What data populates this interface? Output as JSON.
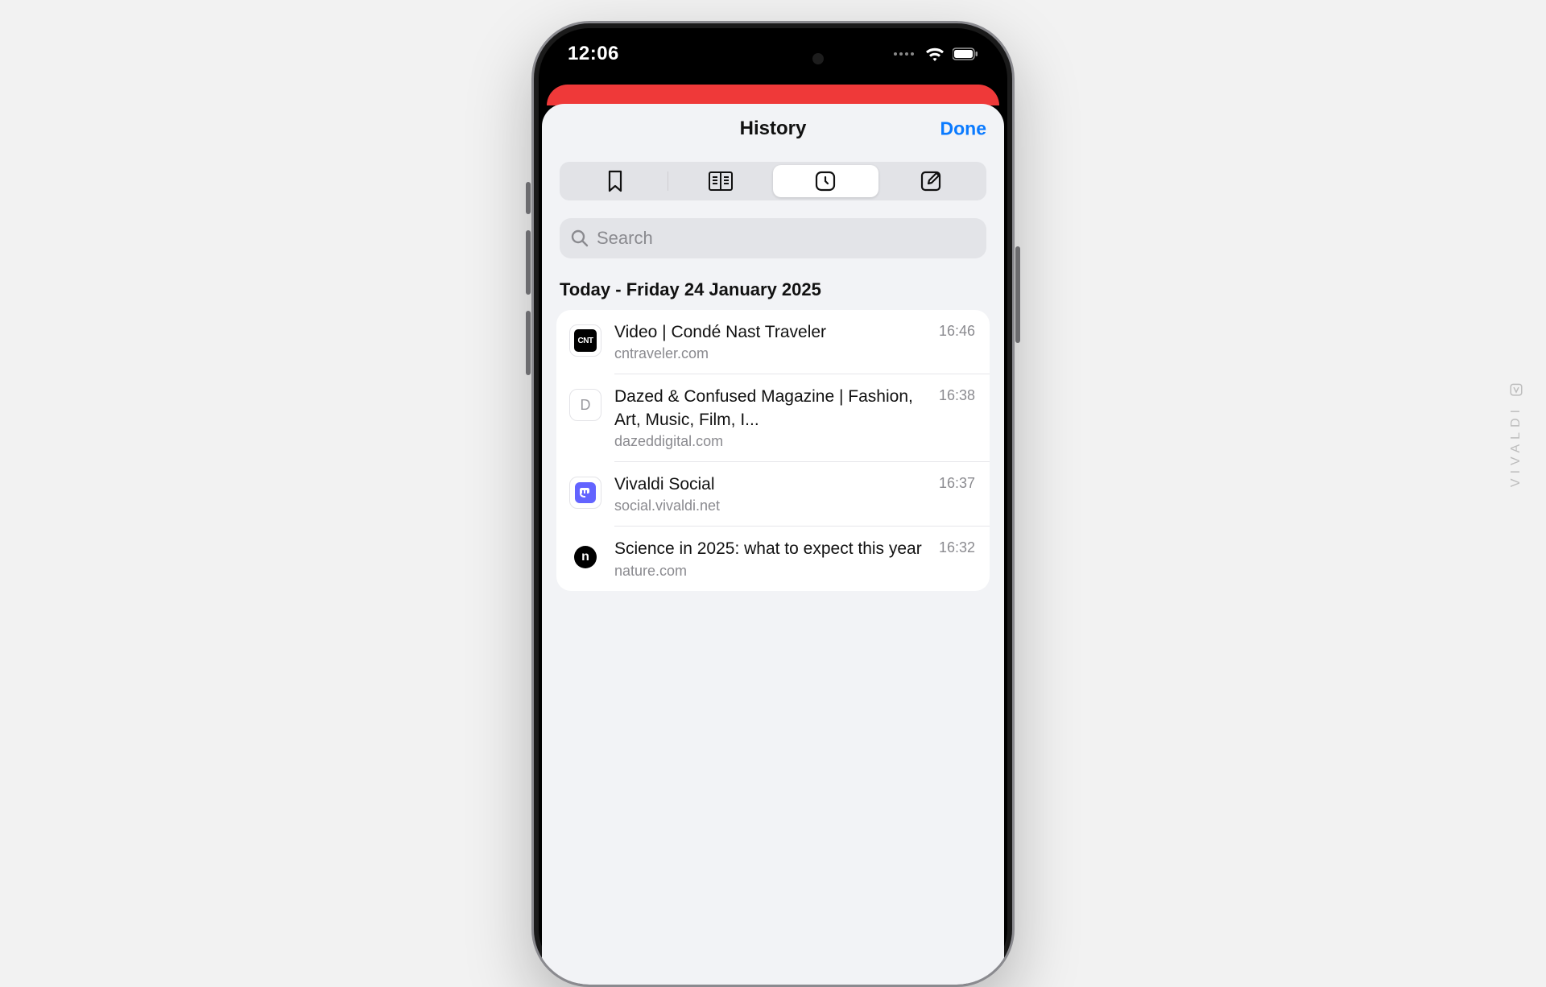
{
  "watermark": "VIVALDI",
  "statusbar": {
    "time": "12:06"
  },
  "sheet": {
    "title": "History",
    "done_label": "Done"
  },
  "tabs": {
    "active_index": 2,
    "items": [
      {
        "id": "bookmarks",
        "icon": "bookmark-icon"
      },
      {
        "id": "reading-list",
        "icon": "reading-list-icon"
      },
      {
        "id": "history",
        "icon": "history-icon"
      },
      {
        "id": "notes",
        "icon": "notes-icon"
      }
    ]
  },
  "search": {
    "placeholder": "Search",
    "value": ""
  },
  "section_header": "Today - Friday 24 January 2025",
  "history": [
    {
      "favicon": "cnt",
      "favicon_label": "CNT",
      "title": "Video | Condé Nast Traveler",
      "domain": "cntraveler.com",
      "time": "16:46"
    },
    {
      "favicon": "letter",
      "favicon_label": "D",
      "title": "Dazed & Confused Magazine | Fashion, Art, Music, Film, I...",
      "domain": "dazeddigital.com",
      "time": "16:38"
    },
    {
      "favicon": "mastodon",
      "favicon_label": "",
      "title": "Vivaldi Social",
      "domain": "social.vivaldi.net",
      "time": "16:37"
    },
    {
      "favicon": "nature",
      "favicon_label": "n",
      "title": "Science in 2025: what to expect this year",
      "domain": "nature.com",
      "time": "16:32"
    }
  ]
}
